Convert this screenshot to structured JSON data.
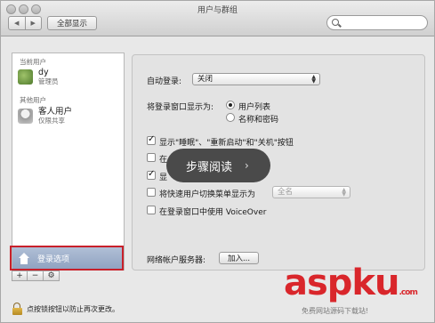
{
  "window": {
    "title": "用户与群组",
    "show_all_label": "全部显示",
    "back_glyph": "◀",
    "forward_glyph": "▶"
  },
  "sidebar": {
    "current_user_section": "当前用户",
    "current_user": {
      "name": "dy",
      "role": "管理员"
    },
    "other_users_section": "其他用户",
    "other_users": [
      {
        "name": "客人用户",
        "role": "仅限共享"
      }
    ],
    "login_options_label": "登录选项",
    "add_label": "+",
    "remove_label": "−",
    "gear_label": "⚙"
  },
  "panel": {
    "auto_login_label": "自动登录:",
    "auto_login_value": "关闭",
    "login_window_label": "将登录窗口显示为:",
    "radio_options": [
      "用户列表",
      "名称和密码"
    ],
    "checkbox_options": [
      {
        "label": "显示\"睡眠\"、\"重新启动\"和\"关机\"按钮",
        "checked": true
      },
      {
        "label": "在",
        "checked": false
      },
      {
        "label": "显",
        "checked": true
      },
      {
        "label": "将快速用户切换菜单显示为",
        "checked": false
      },
      {
        "label": "在登录窗口中使用 VoiceOver",
        "checked": false
      }
    ],
    "fast_switch_value": "全名",
    "network_server_label": "网络帐户服务器:",
    "join_button_label": "加入..."
  },
  "lock_text": "点按锁按钮以防止再次更改。",
  "overlay": {
    "label": "步骤阅读",
    "chevron": "›"
  },
  "watermark": {
    "text": "aspku",
    "suffix": ".com",
    "subtitle": "免费网站源码下载站!"
  },
  "colors": {
    "highlight": "#c8202a",
    "selection": "#8fa2c0",
    "watermark": "#d9262b"
  }
}
